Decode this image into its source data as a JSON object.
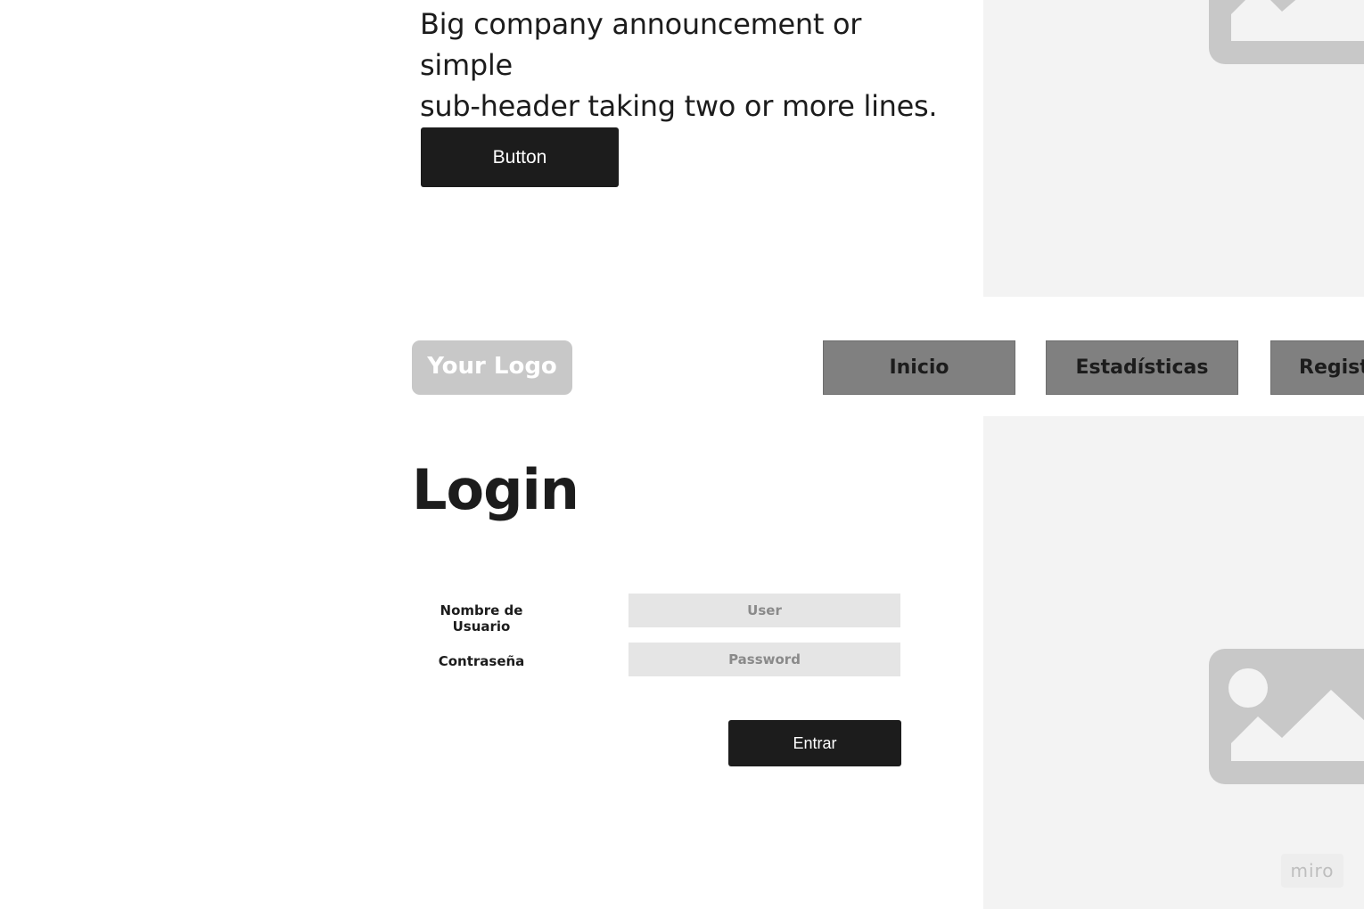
{
  "hero": {
    "subheader_line1": "Big company announcement or simple",
    "subheader_line2": "sub-header taking two or more lines.",
    "button_label": "Button",
    "image_icon": "image-placeholder-icon"
  },
  "nav": {
    "logo_text": "Your Logo",
    "items": [
      {
        "label": "Inicio"
      },
      {
        "label": "Estadísticas"
      },
      {
        "label": "Regist"
      }
    ]
  },
  "login": {
    "title": "Login",
    "username_label": "Nombre de Usuario",
    "username_placeholder": "User",
    "password_label": "Contraseña",
    "password_placeholder": "Password",
    "submit_label": "Entrar",
    "image_icon": "image-placeholder-icon"
  },
  "watermark": {
    "text": "miro"
  },
  "colors": {
    "primary_dark": "#1c1c1c",
    "nav_gray": "#808080",
    "placeholder_panel": "#f3f3f3",
    "placeholder_image": "#c8c8c8",
    "input_bg": "#e5e5e5"
  }
}
